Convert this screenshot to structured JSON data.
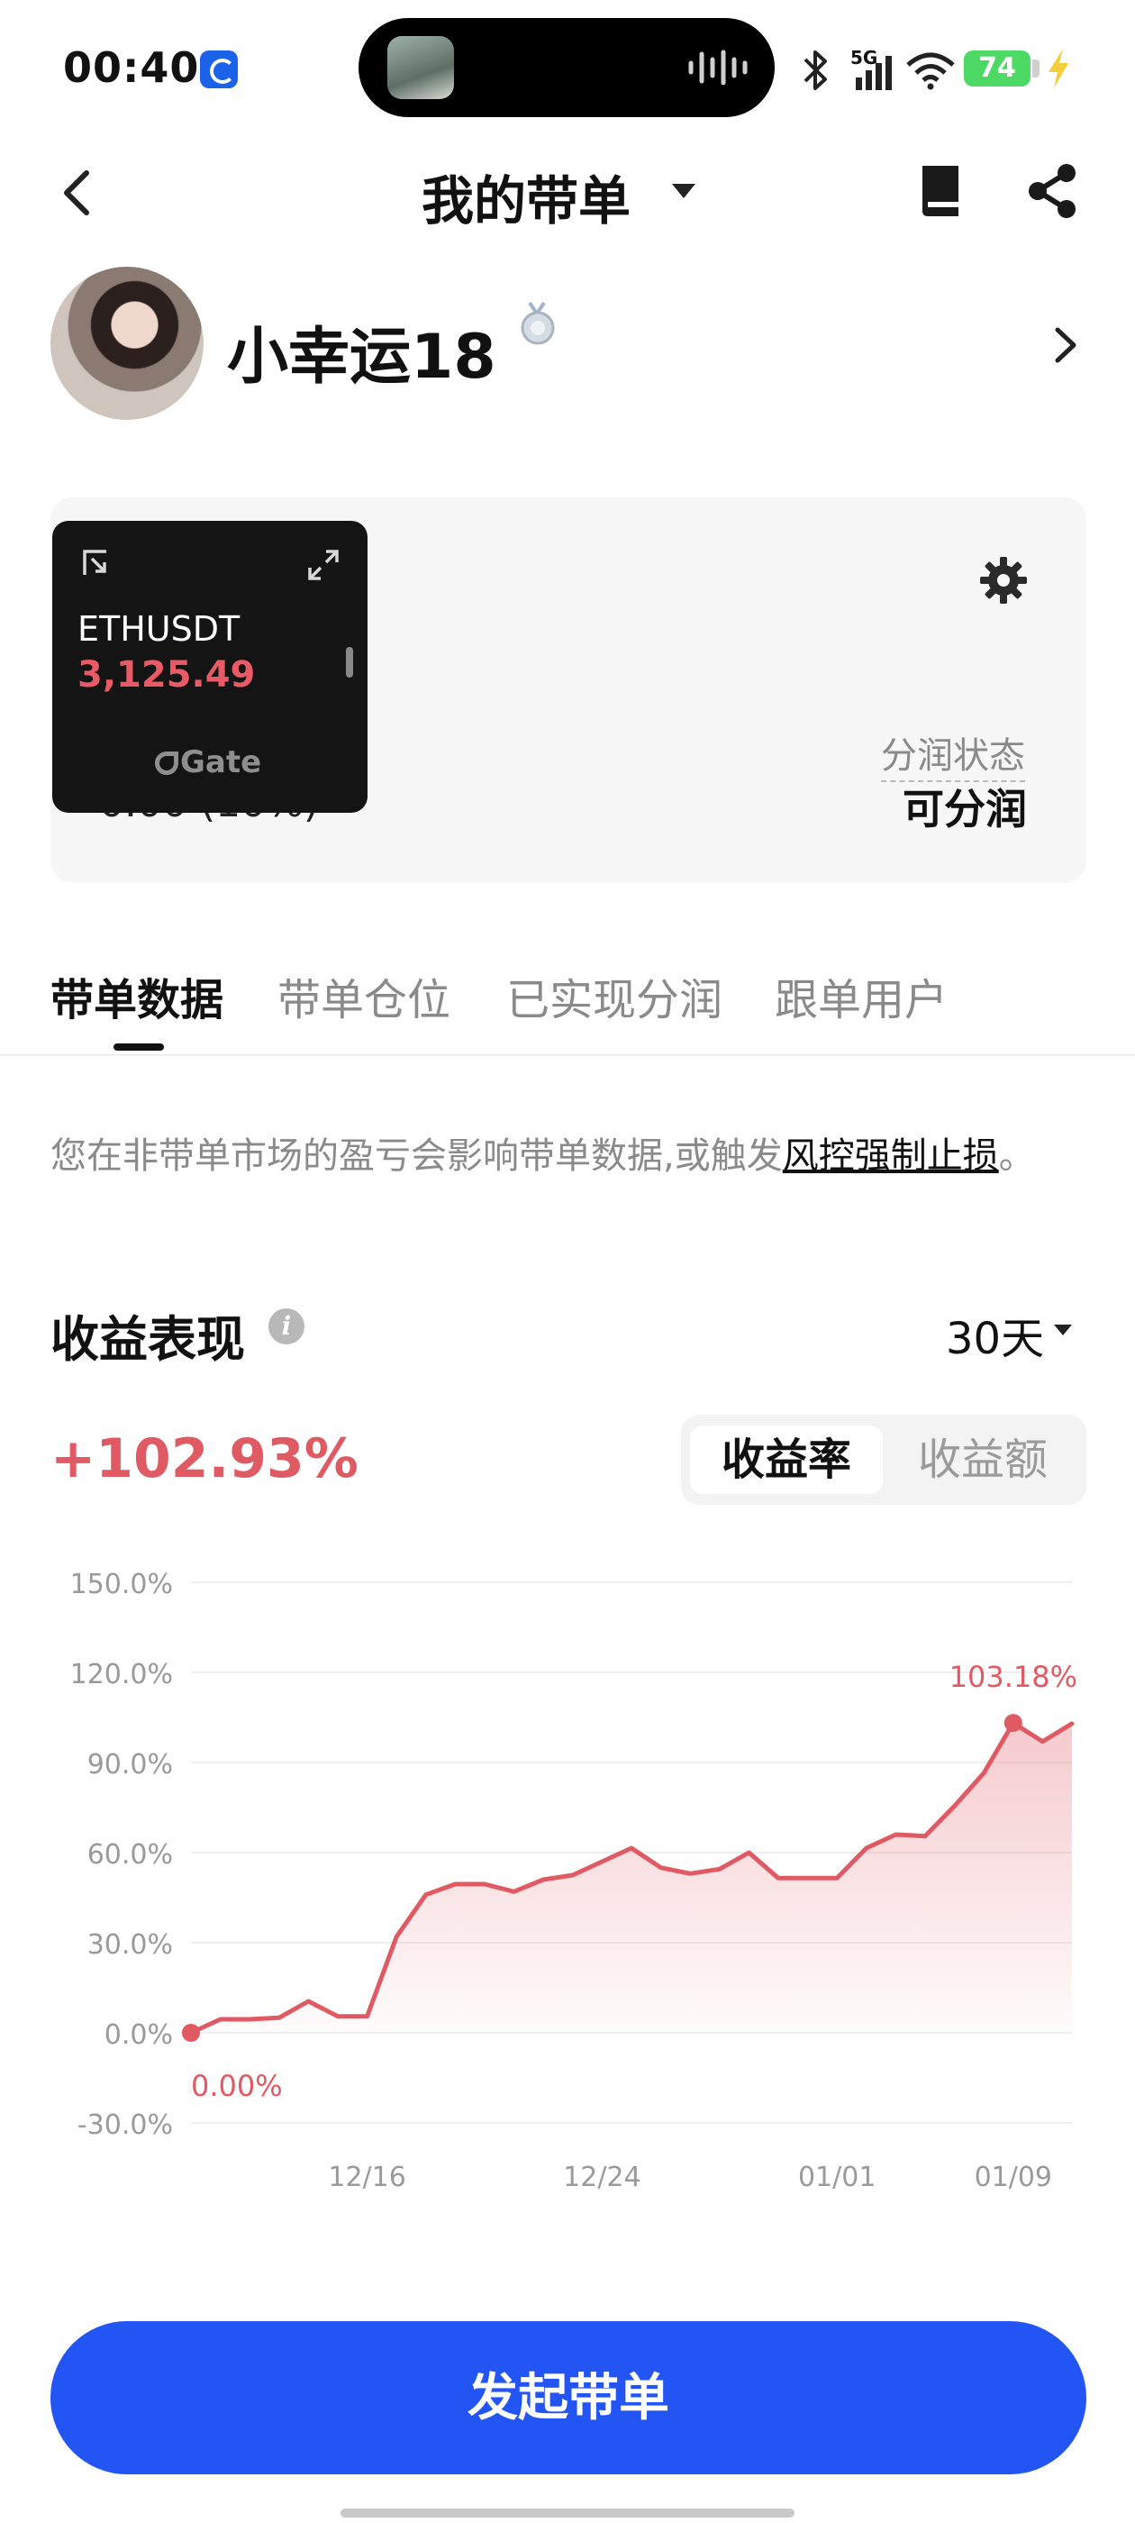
{
  "status_bar": {
    "time": "00:40",
    "network": "5G",
    "battery": "74"
  },
  "nav": {
    "title": "我的带单"
  },
  "profile": {
    "name": "小幸运18"
  },
  "card": {
    "partial_text": "0.00 (10%)",
    "share_status_label": "分润状态",
    "share_status_value": "可分润"
  },
  "widget": {
    "symbol": "ETHUSDT",
    "price": "3,125.49",
    "logo": "Gate"
  },
  "tabs": [
    {
      "label": "带单数据",
      "active": true
    },
    {
      "label": "带单仓位",
      "active": false
    },
    {
      "label": "已实现分润",
      "active": false
    },
    {
      "label": "跟单用户",
      "active": false
    }
  ],
  "notice": {
    "text": "您在非带单市场的盈亏会影响带单数据,或触发",
    "link": "风控强制止损",
    "end": "。"
  },
  "performance": {
    "title": "收益表现",
    "period": "30天",
    "total": "+102.93%",
    "toggle": [
      "收益率",
      "收益额"
    ]
  },
  "colors": {
    "accent_red": "#e05a64",
    "cta_blue": "#2355f5"
  },
  "chart_data": {
    "type": "area",
    "x_ticks": [
      "12/16",
      "12/24",
      "01/01",
      "01/09"
    ],
    "y_ticks": [
      "150.0%",
      "120.0%",
      "90.0%",
      "60.0%",
      "30.0%",
      "0.0%",
      "-30.0%"
    ],
    "ylim": [
      -30,
      150
    ],
    "grid": true,
    "values": [
      0.0,
      4.5,
      4.5,
      5.0,
      10.5,
      5.5,
      5.5,
      32.0,
      46.0,
      49.5,
      49.5,
      47.0,
      51.0,
      52.5,
      57.0,
      61.5,
      55.0,
      53.0,
      54.5,
      60.0,
      51.5,
      51.5,
      51.5,
      61.5,
      66.0,
      65.5,
      75.5,
      86.5,
      103.18,
      97.0,
      102.93
    ],
    "start_label": "0.00%",
    "peak_label": "103.18%",
    "peak_index": 28
  },
  "cta": {
    "label": "发起带单"
  }
}
